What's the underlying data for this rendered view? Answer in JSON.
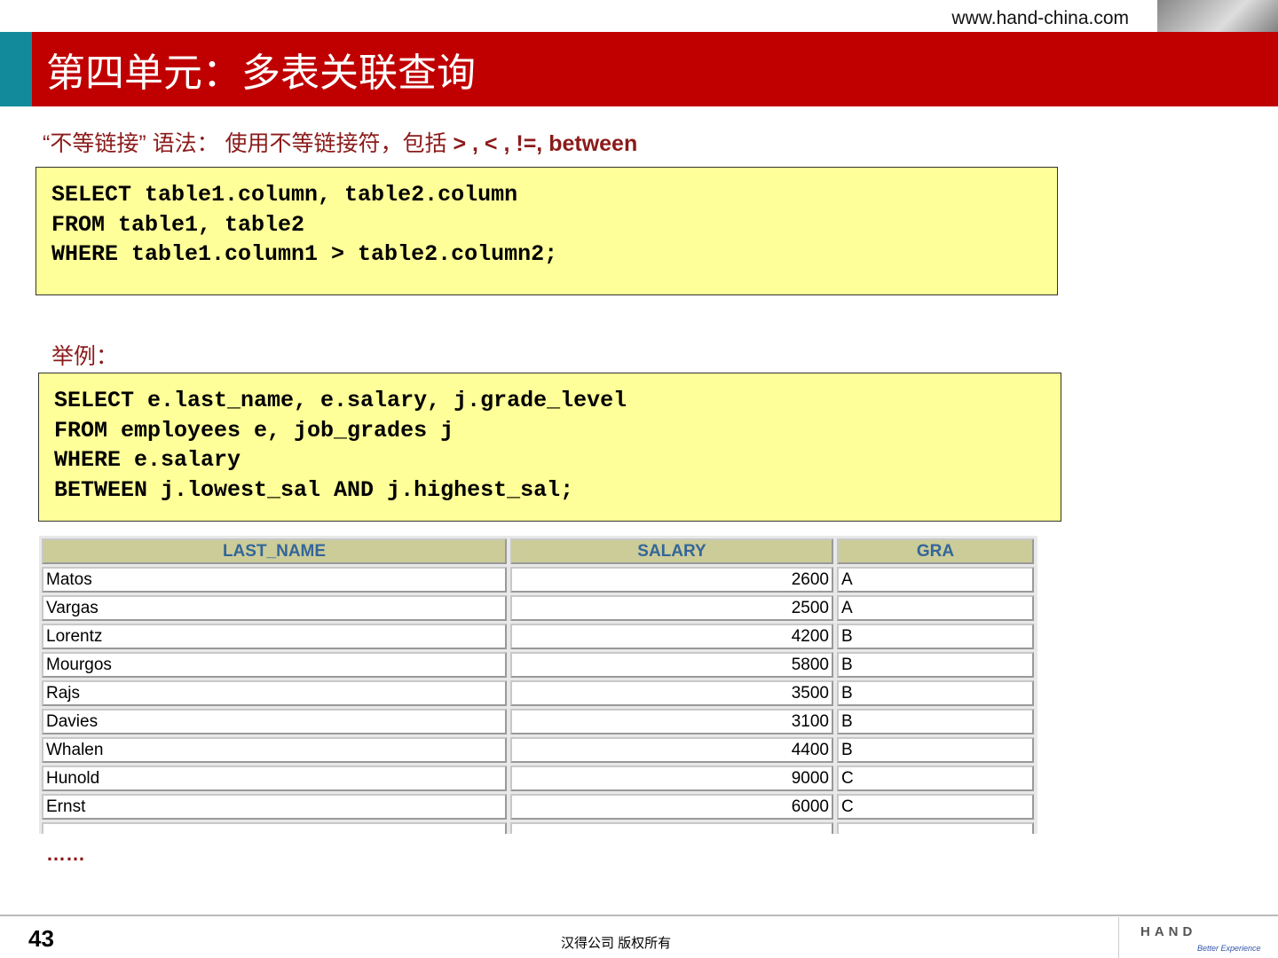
{
  "header": {
    "url": "www.hand-china.com",
    "title": "第四单元：多表关联查询"
  },
  "syntax": {
    "prefix": "“不等链接” 语法：  使用不等链接符，包括 ",
    "operators": "> , < , !=, between"
  },
  "code1": "SELECT table1.column, table2.column\nFROM table1, table2\nWHERE table1.column1 > table2.column2;",
  "example_label": "举例：",
  "code2": "SELECT e.last_name, e.salary, j.grade_level\nFROM employees e, job_grades j\nWHERE e.salary\nBETWEEN j.lowest_sal AND j.highest_sal;",
  "table": {
    "headers": [
      "LAST_NAME",
      "SALARY",
      "GRA"
    ],
    "rows": [
      [
        "Matos",
        "2600",
        "A"
      ],
      [
        "Vargas",
        "2500",
        "A"
      ],
      [
        "Lorentz",
        "4200",
        "B"
      ],
      [
        "Mourgos",
        "5800",
        "B"
      ],
      [
        "Rajs",
        "3500",
        "B"
      ],
      [
        "Davies",
        "3100",
        "B"
      ],
      [
        "Whalen",
        "4400",
        "B"
      ],
      [
        "Hunold",
        "9000",
        "C"
      ],
      [
        "Ernst",
        "6000",
        "C"
      ]
    ]
  },
  "ellipsis": "……",
  "footer": {
    "page": "43",
    "copyright": "汉得公司   版权所有",
    "logo": "HAND",
    "slogan": "Better Experience"
  }
}
